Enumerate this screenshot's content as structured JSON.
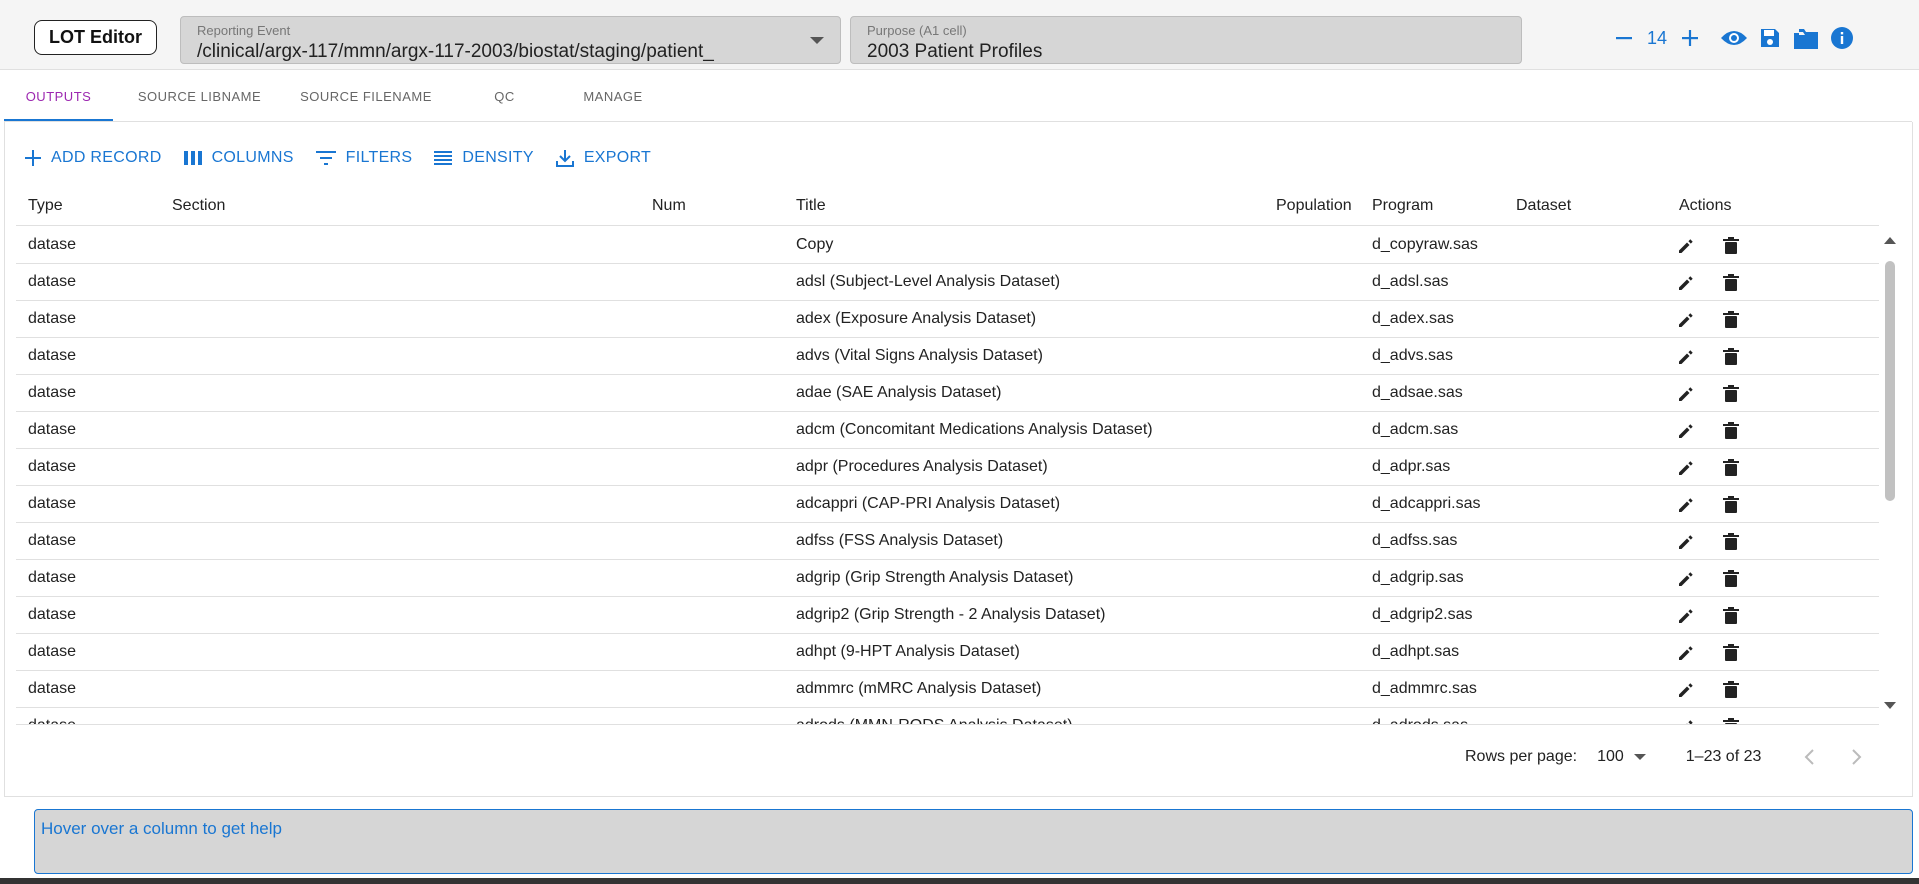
{
  "app": {
    "title": "LOT Editor"
  },
  "header": {
    "reporting_event": {
      "label": "Reporting Event",
      "value": "/clinical/argx-117/mmn/argx-117-2003/biostat/staging/patient_"
    },
    "purpose": {
      "label": "Purpose (A1 cell)",
      "value": "2003 Patient Profiles"
    },
    "zoom": "14",
    "icons": [
      "minus-icon",
      "plus-icon",
      "eye-icon",
      "save-icon",
      "folder-icon",
      "info-icon"
    ]
  },
  "tabs": [
    {
      "label": "OUTPUTS",
      "active": true
    },
    {
      "label": "SOURCE LIBNAME",
      "active": false
    },
    {
      "label": "SOURCE FILENAME",
      "active": false
    },
    {
      "label": "QC",
      "active": false
    },
    {
      "label": "MANAGE",
      "active": false
    }
  ],
  "toolbar": {
    "add_record": "ADD RECORD",
    "columns": "COLUMNS",
    "filters": "FILTERS",
    "density": "DENSITY",
    "export": "EXPORT"
  },
  "grid": {
    "columns": [
      "Type",
      "Section",
      "Num",
      "Title",
      "Population",
      "Program",
      "Dataset",
      "Actions"
    ],
    "rows": [
      {
        "type": "datase",
        "section": "",
        "num": "",
        "title": "Copy",
        "population": "",
        "program": "d_copyraw.sas",
        "dataset": ""
      },
      {
        "type": "datase",
        "section": "",
        "num": "",
        "title": "adsl (Subject-Level Analysis Dataset)",
        "population": "",
        "program": "d_adsl.sas",
        "dataset": ""
      },
      {
        "type": "datase",
        "section": "",
        "num": "",
        "title": "adex (Exposure Analysis Dataset)",
        "population": "",
        "program": "d_adex.sas",
        "dataset": ""
      },
      {
        "type": "datase",
        "section": "",
        "num": "",
        "title": "advs (Vital Signs Analysis Dataset)",
        "population": "",
        "program": "d_advs.sas",
        "dataset": ""
      },
      {
        "type": "datase",
        "section": "",
        "num": "",
        "title": "adae (SAE Analysis Dataset)",
        "population": "",
        "program": "d_adsae.sas",
        "dataset": ""
      },
      {
        "type": "datase",
        "section": "",
        "num": "",
        "title": "adcm (Concomitant Medications Analysis Dataset)",
        "population": "",
        "program": "d_adcm.sas",
        "dataset": ""
      },
      {
        "type": "datase",
        "section": "",
        "num": "",
        "title": "adpr (Procedures Analysis Dataset)",
        "population": "",
        "program": "d_adpr.sas",
        "dataset": ""
      },
      {
        "type": "datase",
        "section": "",
        "num": "",
        "title": "adcappri (CAP-PRI Analysis Dataset)",
        "population": "",
        "program": "d_adcappri.sas",
        "dataset": ""
      },
      {
        "type": "datase",
        "section": "",
        "num": "",
        "title": "adfss (FSS Analysis Dataset)",
        "population": "",
        "program": "d_adfss.sas",
        "dataset": ""
      },
      {
        "type": "datase",
        "section": "",
        "num": "",
        "title": "adgrip (Grip Strength Analysis Dataset)",
        "population": "",
        "program": "d_adgrip.sas",
        "dataset": ""
      },
      {
        "type": "datase",
        "section": "",
        "num": "",
        "title": "adgrip2 (Grip Strength - 2 Analysis Dataset)",
        "population": "",
        "program": "d_adgrip2.sas",
        "dataset": ""
      },
      {
        "type": "datase",
        "section": "",
        "num": "",
        "title": "adhpt (9-HPT Analysis Dataset)",
        "population": "",
        "program": "d_adhpt.sas",
        "dataset": ""
      },
      {
        "type": "datase",
        "section": "",
        "num": "",
        "title": "admmrc (mMRC Analysis Dataset)",
        "population": "",
        "program": "d_admmrc.sas",
        "dataset": ""
      },
      {
        "type": "datase",
        "section": "",
        "num": "",
        "title": "adrods (MMN-RODS Analysis Dataset)",
        "population": "",
        "program": "d_adrods.sas",
        "dataset": ""
      }
    ]
  },
  "pagination": {
    "rows_per_page_label": "Rows per page:",
    "rows_per_page": "100",
    "range": "1–23 of 23"
  },
  "help": {
    "text": "Hover over a column to get help"
  },
  "colors": {
    "accent": "#1976d2",
    "active_tab_text": "#9c27b0",
    "field_bg": "#d6d6d6"
  }
}
